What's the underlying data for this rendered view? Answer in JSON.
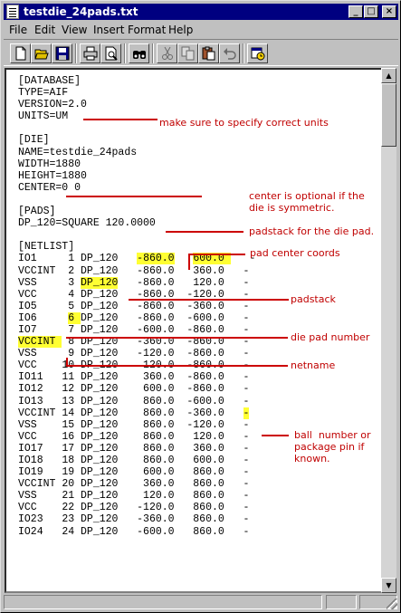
{
  "window": {
    "title": "testdie_24pads.txt"
  },
  "title_buttons": {
    "minimize": "_",
    "maximize": "□",
    "close": "×"
  },
  "menu": [
    "File",
    "Edit",
    "View",
    "Insert",
    "Format",
    "Help"
  ],
  "toolbar": [
    "new-icon",
    "open-icon",
    "save-icon",
    "print-icon",
    "print-preview-icon",
    "find-icon",
    "cut-icon",
    "copy-icon",
    "paste-icon",
    "undo-icon",
    "datetime-icon"
  ],
  "file": {
    "lines": [
      "[DATABASE]",
      "TYPE=AIF",
      "VERSION=2.0",
      "UNITS=UM",
      "",
      "[DIE]",
      "NAME=testdie_24pads",
      "WIDTH=1880",
      "HEIGHT=1880",
      "CENTER=0 0",
      "",
      "[PADS]",
      "DP_120=SQUARE 120.0000",
      "",
      "[NETLIST]"
    ],
    "netlist": [
      [
        "IO1",
        "1",
        "DP_120",
        "-860.0",
        "600.0",
        "-"
      ],
      [
        "VCCINT",
        "2",
        "DP_120",
        "-860.0",
        "360.0",
        "-"
      ],
      [
        "VSS",
        "3",
        "DP_120",
        "-860.0",
        "120.0",
        "-"
      ],
      [
        "VCC",
        "4",
        "DP_120",
        "-860.0",
        "-120.0",
        "-"
      ],
      [
        "IO5",
        "5",
        "DP_120",
        "-860.0",
        "-360.0",
        "-"
      ],
      [
        "IO6",
        "6",
        "DP_120",
        "-860.0",
        "-600.0",
        "-"
      ],
      [
        "IO7",
        "7",
        "DP_120",
        "-600.0",
        "-860.0",
        "-"
      ],
      [
        "VCCINT",
        "8",
        "DP_120",
        "-360.0",
        "-860.0",
        "-"
      ],
      [
        "VSS",
        "9",
        "DP_120",
        "-120.0",
        "-860.0",
        "-"
      ],
      [
        "VCC",
        "10",
        "DP_120",
        "120.0",
        "-860.0",
        "-"
      ],
      [
        "IO11",
        "11",
        "DP_120",
        "360.0",
        "-860.0",
        "-"
      ],
      [
        "IO12",
        "12",
        "DP_120",
        "600.0",
        "-860.0",
        "-"
      ],
      [
        "IO13",
        "13",
        "DP_120",
        "860.0",
        "-600.0",
        "-"
      ],
      [
        "VCCINT",
        "14",
        "DP_120",
        "860.0",
        "-360.0",
        "-"
      ],
      [
        "VSS",
        "15",
        "DP_120",
        "860.0",
        "-120.0",
        "-"
      ],
      [
        "VCC",
        "16",
        "DP_120",
        "860.0",
        "120.0",
        "-"
      ],
      [
        "IO17",
        "17",
        "DP_120",
        "860.0",
        "360.0",
        "-"
      ],
      [
        "IO18",
        "18",
        "DP_120",
        "860.0",
        "600.0",
        "-"
      ],
      [
        "IO19",
        "19",
        "DP_120",
        "600.0",
        "860.0",
        "-"
      ],
      [
        "VCCINT",
        "20",
        "DP_120",
        "360.0",
        "860.0",
        "-"
      ],
      [
        "VSS",
        "21",
        "DP_120",
        "120.0",
        "860.0",
        "-"
      ],
      [
        "VCC",
        "22",
        "DP_120",
        "-120.0",
        "860.0",
        "-"
      ],
      [
        "IO23",
        "23",
        "DP_120",
        "-360.0",
        "860.0",
        "-"
      ],
      [
        "IO24",
        "24",
        "DP_120",
        "-600.0",
        "860.0",
        "-"
      ]
    ]
  },
  "annotations": {
    "units": "make sure to specify correct units",
    "center": "center is optional if the\ndie is symmetric.",
    "padstack_def": "padstack for the die pad.",
    "pad_center": "pad center coords",
    "padstack": "padstack",
    "die_pad_number": "die pad number",
    "netname": "netname",
    "ball_number": "ball  number or\npackage pin if\nknown."
  },
  "colors": {
    "highlight": "#ffff33",
    "annotation": "#c00000",
    "titlebar": "#000080"
  }
}
